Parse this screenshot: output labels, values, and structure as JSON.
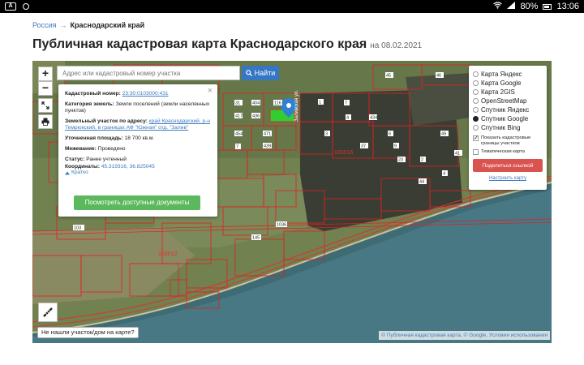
{
  "statusbar": {
    "battery": "80%",
    "time": "13:06",
    "icons": [
      "app-icon",
      "notification-icon",
      "wifi-icon",
      "signal-icon",
      "battery-icon"
    ]
  },
  "breadcrumb": {
    "root": "Россия",
    "separator": "→",
    "current": "Краснодарский край"
  },
  "page": {
    "title": "Публичная кадастровая карта Краснодарского края",
    "date_label": "на 08.02.2021"
  },
  "search": {
    "placeholder": "Адрес или кадастровый номер участка",
    "button_label": "Найти"
  },
  "zoom": {
    "in": "+",
    "out": "−"
  },
  "popup": {
    "cadastral_number_label": "Кадастровый номер:",
    "cadastral_number": "23:30:0103000:431",
    "category_label": "Категория земель:",
    "category_value": "Земли поселений (земли населенных пунктов)",
    "address_label": "Земельный участок по адресу:",
    "address_value": "край Краснодарский, р-н Темрюкский, в границах АФ \"Южная\" отд. \"Залив\"",
    "area_label": "Уточненная площадь:",
    "area_value": "18 700 кв.м.",
    "survey_label": "Межевание:",
    "survey_value": "Проведено",
    "status_label": "Статус:",
    "status_value": "Ранее учтенный",
    "coords_label": "Координаты:",
    "coords_value": "45.319316, 36.825045",
    "collapse_label": "Кратко",
    "docs_button": "Посмотреть доступные документы"
  },
  "layers": {
    "options": [
      {
        "label": "Карта Яндекс",
        "selected": false
      },
      {
        "label": "Карта Google",
        "selected": false
      },
      {
        "label": "Карта 2GIS",
        "selected": false
      },
      {
        "label": "OpenStreetMap",
        "selected": false
      },
      {
        "label": "Спутник Яндекс",
        "selected": false
      },
      {
        "label": "Спутник Google",
        "selected": true
      },
      {
        "label": "Спутник Bing",
        "selected": false
      }
    ],
    "show_borders_label": "Показать кадастровые границы участков",
    "show_borders_checked": true,
    "thematic_label": "Тематическая карта",
    "thematic_checked": false,
    "share_button": "Поделиться ссылкой",
    "setup_link": "Настроить карту"
  },
  "map_labels": {
    "parcels": [
      "1",
      "45",
      "46",
      "103",
      "116",
      "417",
      "404",
      "436",
      "471",
      "7",
      "454",
      "7",
      "434",
      "4",
      "31",
      "439",
      "3",
      "37",
      "6",
      "9",
      "23",
      "2",
      "49",
      "4",
      "41",
      "44",
      "145",
      "1036",
      "103016",
      "103012"
    ],
    "street": "Заливская ул."
  },
  "not_found_label": "Не нашли участок/дом на карте?",
  "attribution": {
    "pkk": "© Публичная кадастровая карта",
    "google": "© Google",
    "terms": "Условия использования"
  },
  "colors": {
    "link": "#3f7bbf",
    "search_button": "#3577c4",
    "docs_button": "#5cb85c",
    "share_button": "#d9534f",
    "parcel_border": "#e02020",
    "selected_parcel": "#33cc33",
    "marker": "#2f80d0"
  }
}
